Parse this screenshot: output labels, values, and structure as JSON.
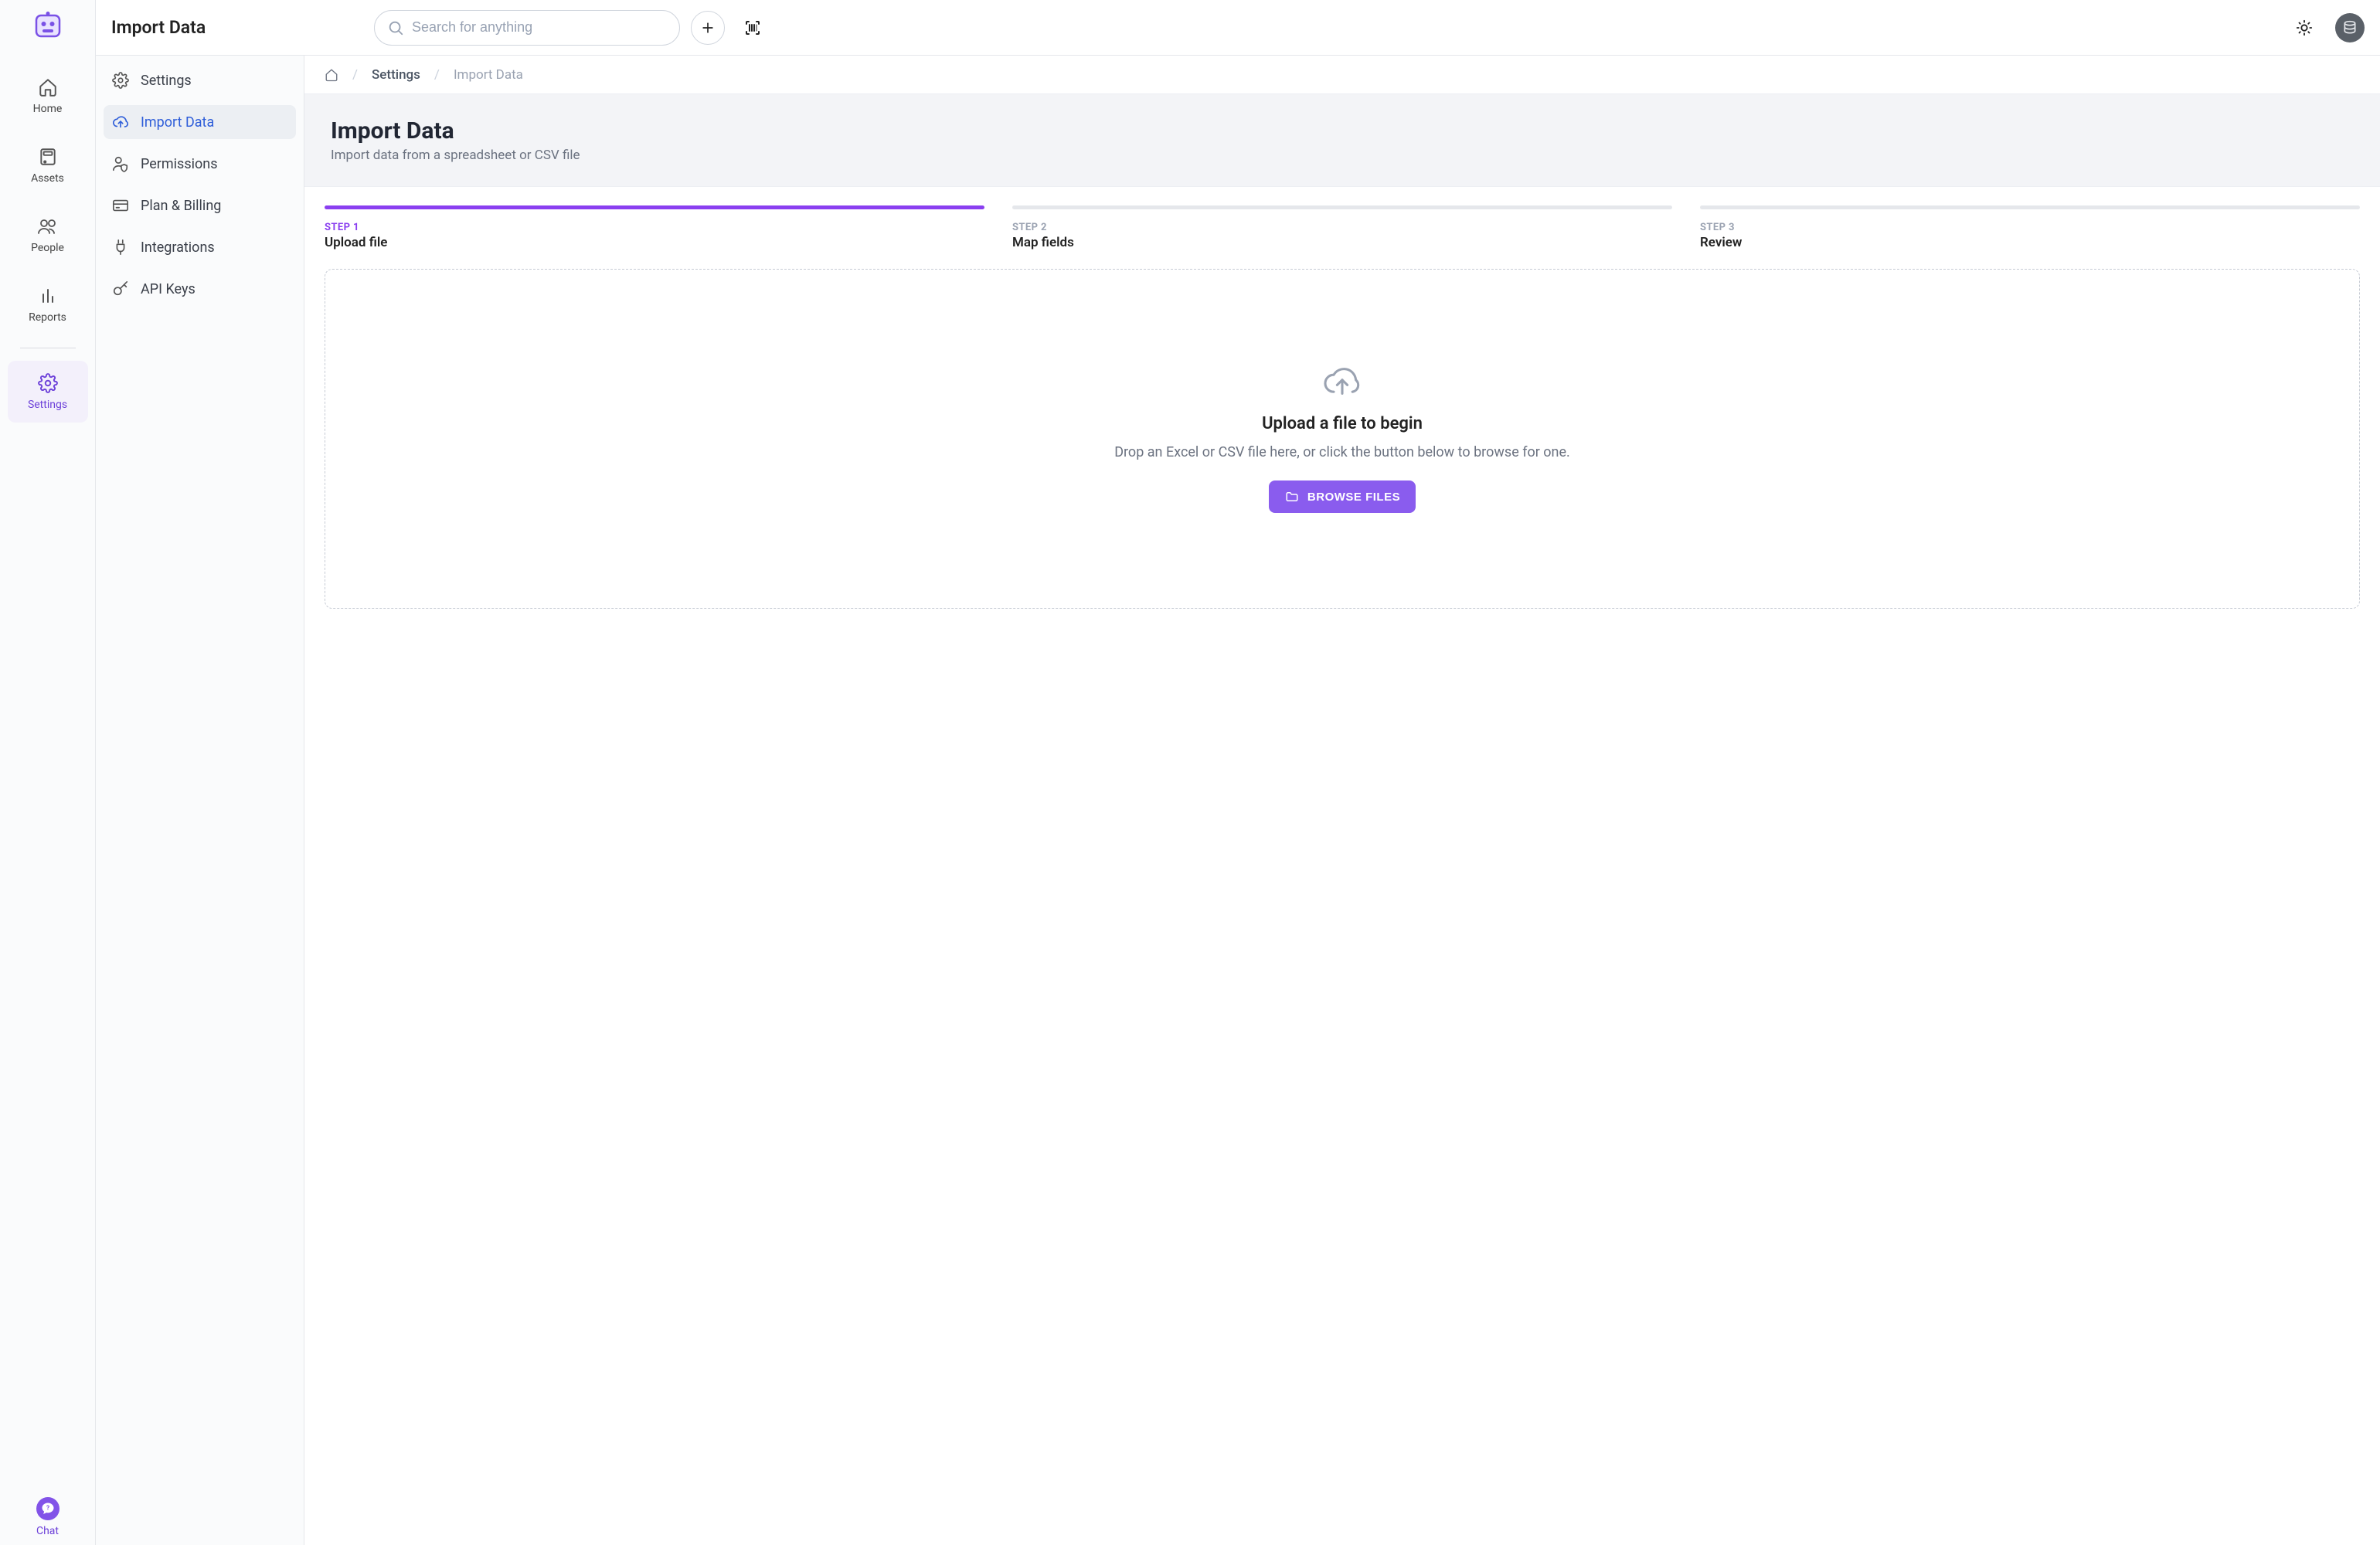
{
  "topbar": {
    "title": "Import Data",
    "search_placeholder": "Search for anything"
  },
  "nav": {
    "items": [
      {
        "label": "Home"
      },
      {
        "label": "Assets"
      },
      {
        "label": "People"
      },
      {
        "label": "Reports"
      }
    ],
    "settings_label": "Settings",
    "chat_label": "Chat"
  },
  "sidebar": {
    "items": [
      {
        "label": "Settings"
      },
      {
        "label": "Import Data"
      },
      {
        "label": "Permissions"
      },
      {
        "label": "Plan & Billing"
      },
      {
        "label": "Integrations"
      },
      {
        "label": "API Keys"
      }
    ]
  },
  "breadcrumb": {
    "link1": "Settings",
    "current": "Import Data"
  },
  "hero": {
    "title": "Import Data",
    "subtitle": "Import data from a spreadsheet or CSV file"
  },
  "steps": [
    {
      "step": "STEP 1",
      "name": "Upload file"
    },
    {
      "step": "STEP 2",
      "name": "Map fields"
    },
    {
      "step": "STEP 3",
      "name": "Review"
    }
  ],
  "dropzone": {
    "title": "Upload a file to begin",
    "subtitle": "Drop an Excel or CSV file here, or click the button below to browse for one.",
    "button": "BROWSE FILES"
  }
}
